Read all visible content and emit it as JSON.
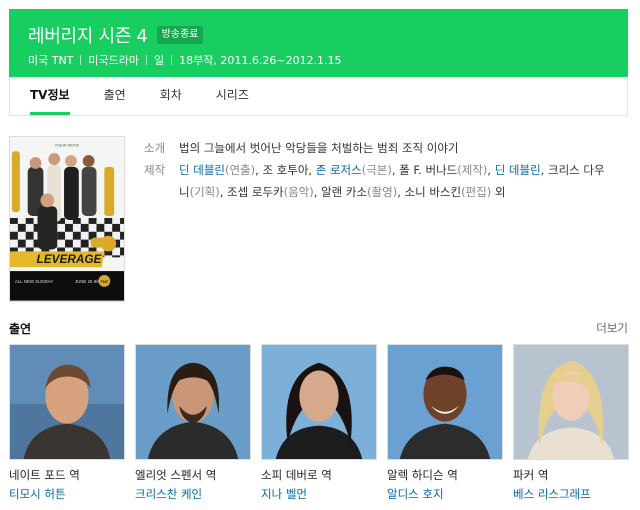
{
  "header": {
    "title": "레버리지 시즌 4",
    "badge": "방송종료",
    "meta": [
      "미국 TNT",
      "미국드라마",
      "일",
      "18부작, 2011.6.26~2012.1.15"
    ]
  },
  "tabs": [
    {
      "label": "TV정보",
      "active": true
    },
    {
      "label": "출연",
      "active": false
    },
    {
      "label": "회차",
      "active": false
    },
    {
      "label": "시리즈",
      "active": false
    }
  ],
  "poster": {
    "logo": "LEVERAGE",
    "top_text": "THEIR MOVE",
    "bottom_text": "ALL NEW SUNDAY",
    "date_text": "JUNE 26 9/8c",
    "network": "TNT"
  },
  "info": {
    "summary_label": "소개",
    "summary": "법의 그늘에서 벗어난 악당들을 처벌하는 범죄 조직 이야기",
    "crew_label": "제작",
    "crew": [
      {
        "name": "딘 데블린",
        "role": "(연출)",
        "link": true
      },
      {
        "name": "조 호투아",
        "role": "",
        "link": false
      },
      {
        "name": "존 로저스",
        "role": "(극본)",
        "link": true
      },
      {
        "name": "폴 F. 버나드",
        "role": "(제작)",
        "link": false
      },
      {
        "name": "딘 데블린",
        "role": "",
        "link": true
      },
      {
        "name": "크리스 다우니",
        "role": "(기획)",
        "link": false
      },
      {
        "name": "조셉 로두카",
        "role": "(음악)",
        "link": false
      },
      {
        "name": "알랜 카소",
        "role": "(촬영)",
        "link": false
      },
      {
        "name": "소니 바스킨",
        "role": "(편집)",
        "link": false
      }
    ],
    "crew_suffix": "외"
  },
  "cast_section": {
    "title": "출연",
    "more": "더보기"
  },
  "cast": [
    {
      "role": "네이트 포드 역",
      "actor": "티모시 허튼",
      "actor_link": true
    },
    {
      "role": "엘리엇 스펜서 역",
      "actor": "크리스찬 케인",
      "actor_link": true
    },
    {
      "role": "소피 데버로 역",
      "actor": "지나 벨먼",
      "actor_link": true
    },
    {
      "role": "알렉 하디슨 역",
      "actor": "알디스 호지",
      "actor_link": true
    },
    {
      "role": "파커 역",
      "actor": "베스 리스그래프",
      "actor_link": true
    }
  ],
  "colors": {
    "brand": "#19ce60",
    "link": "#006ba4"
  }
}
